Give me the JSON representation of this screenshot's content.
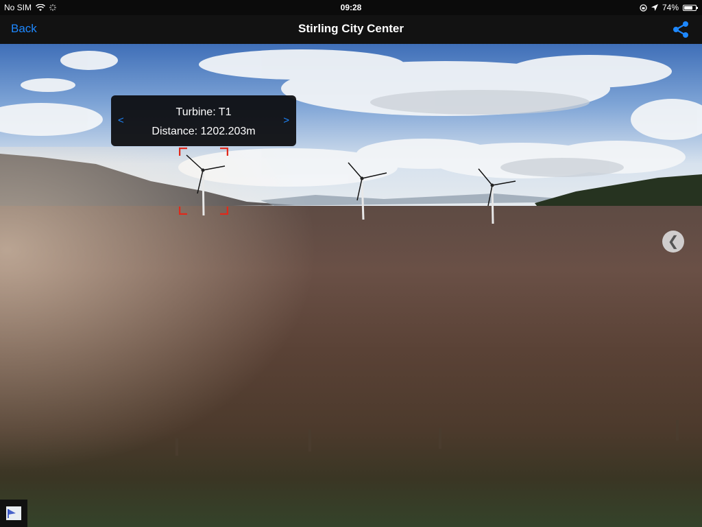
{
  "status": {
    "carrier": "No SIM",
    "time": "09:28",
    "battery": "74%",
    "battery_level": 0.74,
    "icons": [
      "wifi-icon",
      "activity-icon",
      "rotation-lock-icon",
      "location-arrow-icon",
      "battery-icon"
    ]
  },
  "nav": {
    "back_label": "Back",
    "title": "Stirling City Center",
    "share_icon": "share-icon"
  },
  "turbine_info": {
    "turbine": "Turbine: T1",
    "distance": "Distance: 1202.203m",
    "prev_label": "<",
    "next_label": ">"
  },
  "side_toggle": {
    "label": "❮"
  },
  "colors": {
    "accent": "#1e88ff",
    "selection": "#e0291b",
    "bar": "#121212"
  }
}
